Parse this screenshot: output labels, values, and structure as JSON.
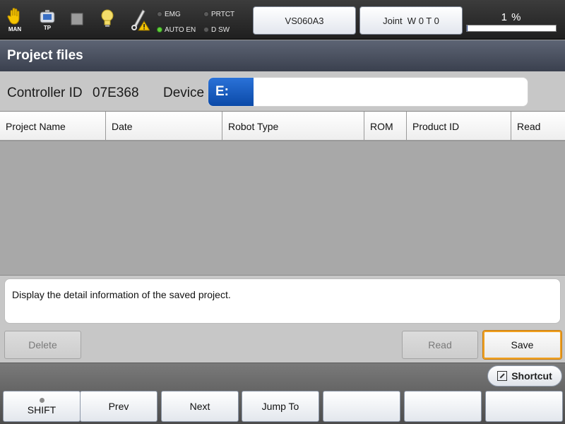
{
  "statusbar": {
    "mode_icon": "hand-icon",
    "mode_label": "MAN",
    "pendant_icon": "teach-pendant-icon",
    "pendant_label": "TP",
    "stop_icon": "stop-square-icon",
    "lamp_icon": "light-bulb-icon",
    "maintenance_icon": "wrench-warning-icon",
    "leds": [
      {
        "label": "EMG",
        "on": false
      },
      {
        "label": "PRTCT",
        "on": false
      },
      {
        "label": "AUTO EN",
        "on": true
      },
      {
        "label": "D SW",
        "on": false
      }
    ],
    "robot_model": "VS060A3",
    "coordinate": "Joint  W 0 T 0",
    "speed_label": "1 %",
    "speed_percent": 1
  },
  "title": "Project files",
  "info": {
    "controller_label": "Controller ID",
    "controller_id": "07E368",
    "device_label": "Device",
    "device_drive": "E:",
    "device_value": ""
  },
  "table": {
    "columns": [
      "Project Name",
      "Date",
      "Robot Type",
      "ROM",
      "Product ID",
      "Read"
    ],
    "rows": []
  },
  "description": "Display the detail information of the saved project.",
  "actions": {
    "delete_label": "Delete",
    "read_label": "Read",
    "save_label": "Save"
  },
  "footer": {
    "shortcut_label": "Shortcut",
    "shift_label": "SHIFT",
    "prev_label": "Prev",
    "next_label": "Next",
    "jump_label": "Jump To",
    "f5_label": "",
    "f6_label": "",
    "f7_label": ""
  },
  "colors": {
    "accent_orange": "#f0a020",
    "drive_blue": "#0b4aa8",
    "led_on": "#5fd13a"
  }
}
